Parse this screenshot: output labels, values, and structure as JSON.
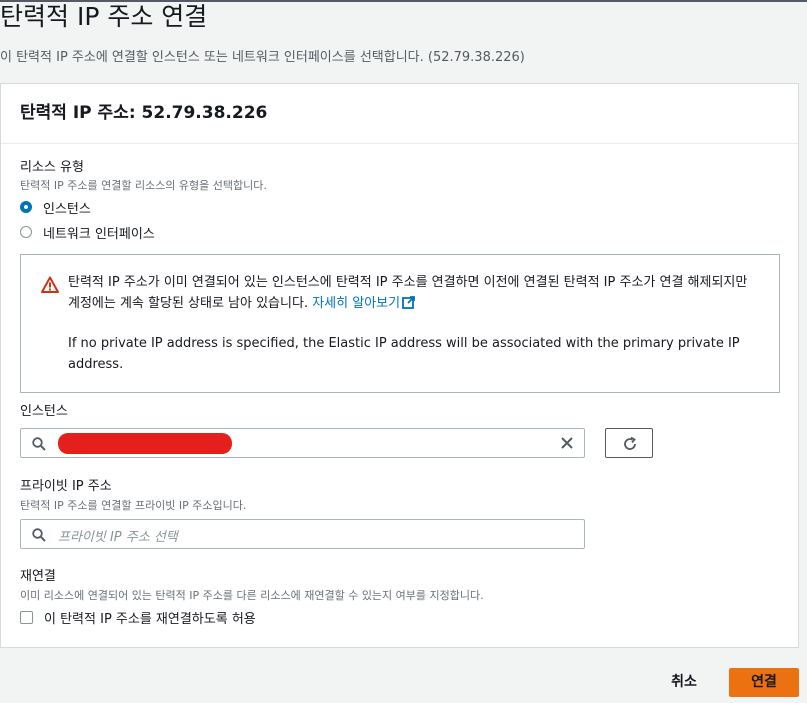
{
  "page": {
    "title": "탄력적 IP 주소 연결",
    "description": "이 탄력적 IP 주소에 연결할 인스턴스 또는 네트워크 인터페이스를 선택합니다. (52.79.38.226)"
  },
  "panel": {
    "title": "탄력적 IP 주소: 52.79.38.226"
  },
  "resource_type": {
    "label": "리소스 유형",
    "description": "탄력적 IP 주소를 연결할 리소스의 유형을 선택합니다.",
    "options": [
      {
        "label": "인스턴스",
        "selected": true
      },
      {
        "label": "네트워크 인터페이스",
        "selected": false
      }
    ]
  },
  "alert": {
    "icon": "warning-icon",
    "color": "#d13212",
    "text": "탄력적 IP 주소가 이미 연결되어 있는 인스턴스에 탄력적 IP 주소를 연결하면 이전에 연결된 탄력적 IP 주소가 연결 해제되지만 계정에는 계속 할당된 상태로 남아 있습니다.",
    "link_text": "자세히 알아보기",
    "note": "If no private IP address is specified, the Elastic IP address will be associated with the primary private IP address."
  },
  "instance": {
    "label": "인스턴스",
    "value_redacted": true
  },
  "private_ip": {
    "label": "프라이빗 IP 주소",
    "description": "탄력적 IP 주소를 연결할 프라이빗 IP 주소입니다.",
    "placeholder": "프라이빗 IP 주소 선택"
  },
  "reassociation": {
    "label": "재연결",
    "description": "이미 리소스에 연결되어 있는 탄력적 IP 주소를 다른 리소스에 재연결할 수 있는지 여부를 지정합니다.",
    "checkbox_label": "이 탄력적 IP 주소를 재연결하도록 허용",
    "checked": false
  },
  "footer": {
    "cancel_label": "취소",
    "submit_label": "연결"
  },
  "colors": {
    "accent": "#0073bb",
    "primary_button": "#ec7211",
    "redaction": "#e3201b"
  }
}
